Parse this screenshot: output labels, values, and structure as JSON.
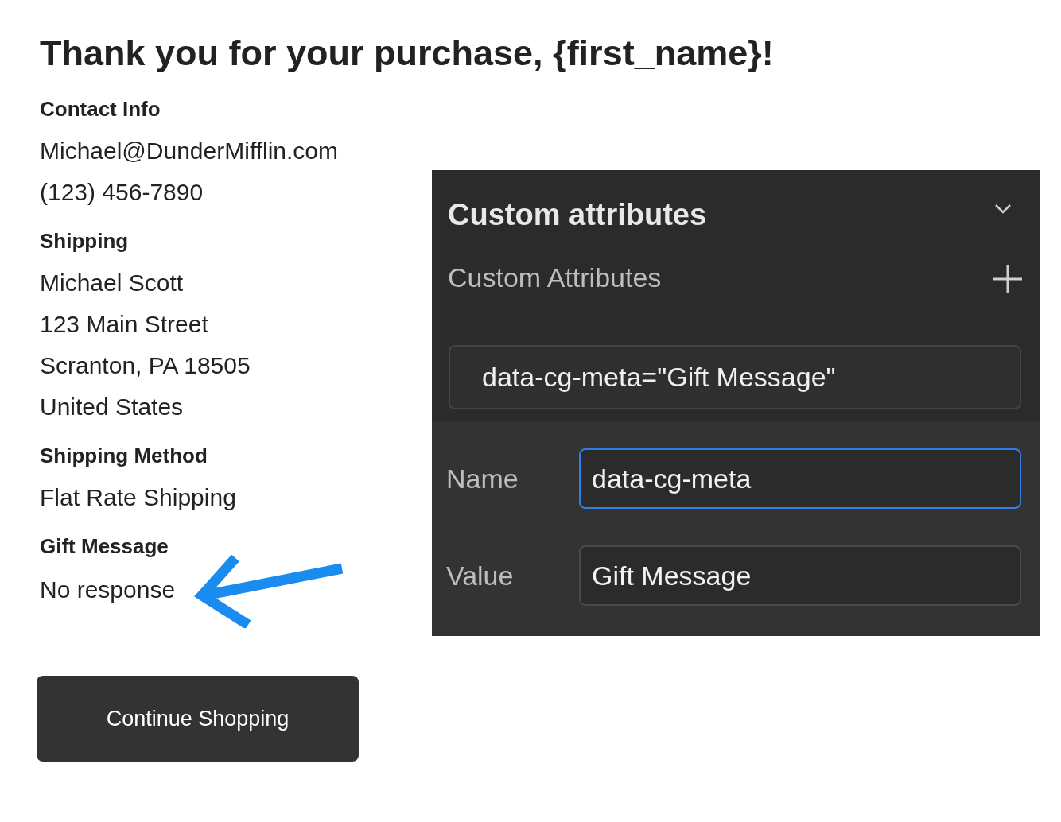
{
  "heading": "Thank you for your purchase, {first_name}!",
  "sections": [
    {
      "title": "Contact Info",
      "lines": [
        "Michael@DunderMifflin.com",
        "(123) 456-7890"
      ],
      "arrow": false
    },
    {
      "title": "Shipping",
      "lines": [
        "Michael Scott",
        "123 Main Street",
        "Scranton, PA 18505",
        "United States"
      ],
      "arrow": false
    },
    {
      "title": "Shipping Method",
      "lines": [
        "Flat Rate Shipping"
      ],
      "arrow": false
    },
    {
      "title": "Gift Message",
      "lines": [
        "No response"
      ],
      "arrow": true
    }
  ],
  "button": "Continue Shopping",
  "panel": {
    "title": "Custom attributes",
    "section_label": "Custom Attributes",
    "attributes": [
      "data-cg-meta=\"Gift Message\""
    ],
    "fields": [
      {
        "label": "Name",
        "value": "data-cg-meta",
        "focused": true
      },
      {
        "label": "Value",
        "value": "Gift Message",
        "focused": false
      }
    ]
  }
}
